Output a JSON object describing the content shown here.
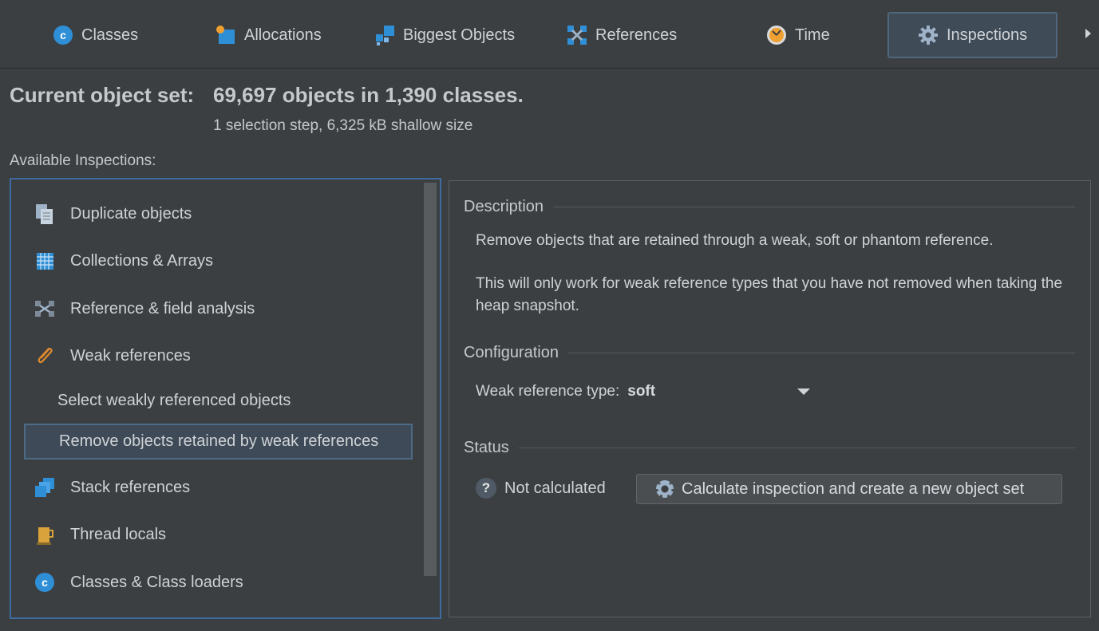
{
  "tabs": [
    {
      "label": "Classes",
      "icon": "class-icon"
    },
    {
      "label": "Allocations",
      "icon": "allocations-icon"
    },
    {
      "label": "Biggest Objects",
      "icon": "biggest-objects-icon"
    },
    {
      "label": "References",
      "icon": "references-icon"
    },
    {
      "label": "Time",
      "icon": "time-icon"
    },
    {
      "label": "Inspections",
      "icon": "gear-icon",
      "active": true
    }
  ],
  "header": {
    "current_label": "Current object set:",
    "current_value": "69,697 objects in 1,390 classes.",
    "sub": "1 selection step, 6,325 kB shallow size",
    "available_label": "Available Inspections:"
  },
  "inspections": [
    {
      "label": "Duplicate objects",
      "icon": "duplicate-objects-icon"
    },
    {
      "label": "Collections & Arrays",
      "icon": "collections-arrays-icon"
    },
    {
      "label": "Reference & field analysis",
      "icon": "reference-field-icon"
    },
    {
      "label": "Weak references",
      "icon": "weak-references-icon"
    },
    {
      "label": "Select weakly referenced objects",
      "sub": true
    },
    {
      "label": "Remove objects retained by weak references",
      "sub": true,
      "selected": true
    },
    {
      "label": "Stack references",
      "icon": "stack-references-icon"
    },
    {
      "label": "Thread locals",
      "icon": "thread-locals-icon"
    },
    {
      "label": "Classes & Class loaders",
      "icon": "class-icon"
    }
  ],
  "detail": {
    "description_title": "Description",
    "description_line1": "Remove objects that are retained through a weak, soft or phantom reference.",
    "description_line2": "This will only work for weak reference types that you have not removed when taking the heap snapshot.",
    "configuration_title": "Configuration",
    "weak_type_label": "Weak reference type:",
    "weak_type_value": "soft",
    "status_title": "Status",
    "status_text": "Not calculated",
    "status_icon_glyph": "?",
    "calc_button": "Calculate inspection and create a new object set"
  },
  "colors": {
    "background": "#3c3f41",
    "selection_border": "#3d6aa0",
    "active_tab": "#3f4b57"
  }
}
